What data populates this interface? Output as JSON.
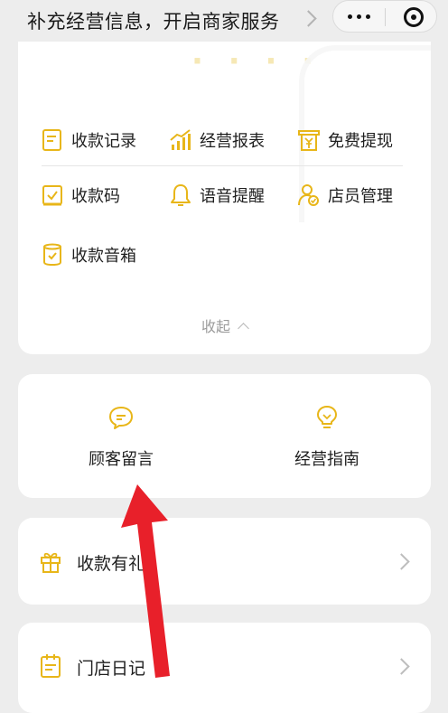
{
  "nav": {
    "title": "补充经营信息，开启商家服务"
  },
  "menu": {
    "items": [
      {
        "label": "收款记录",
        "icon": "receipt-record-icon"
      },
      {
        "label": "经营报表",
        "icon": "bar-chart-icon"
      },
      {
        "label": "免费提现",
        "icon": "yuan-withdraw-icon"
      },
      {
        "label": "收款码",
        "icon": "qr-code-icon"
      },
      {
        "label": "语音提醒",
        "icon": "bell-icon"
      },
      {
        "label": "店员管理",
        "icon": "staff-icon"
      },
      {
        "label": "收款音箱",
        "icon": "speaker-icon"
      }
    ],
    "collapse_label": "收起"
  },
  "quick": {
    "items": [
      {
        "label": "顾客留言",
        "icon": "message-bubble-icon"
      },
      {
        "label": "经营指南",
        "icon": "lightbulb-icon"
      }
    ]
  },
  "rows": [
    {
      "label": "收款有礼",
      "icon": "gift-icon"
    },
    {
      "label": "门店日记",
      "icon": "notebook-icon"
    }
  ],
  "colors": {
    "accent": "#e8b619",
    "arrow": "#e8202a"
  }
}
